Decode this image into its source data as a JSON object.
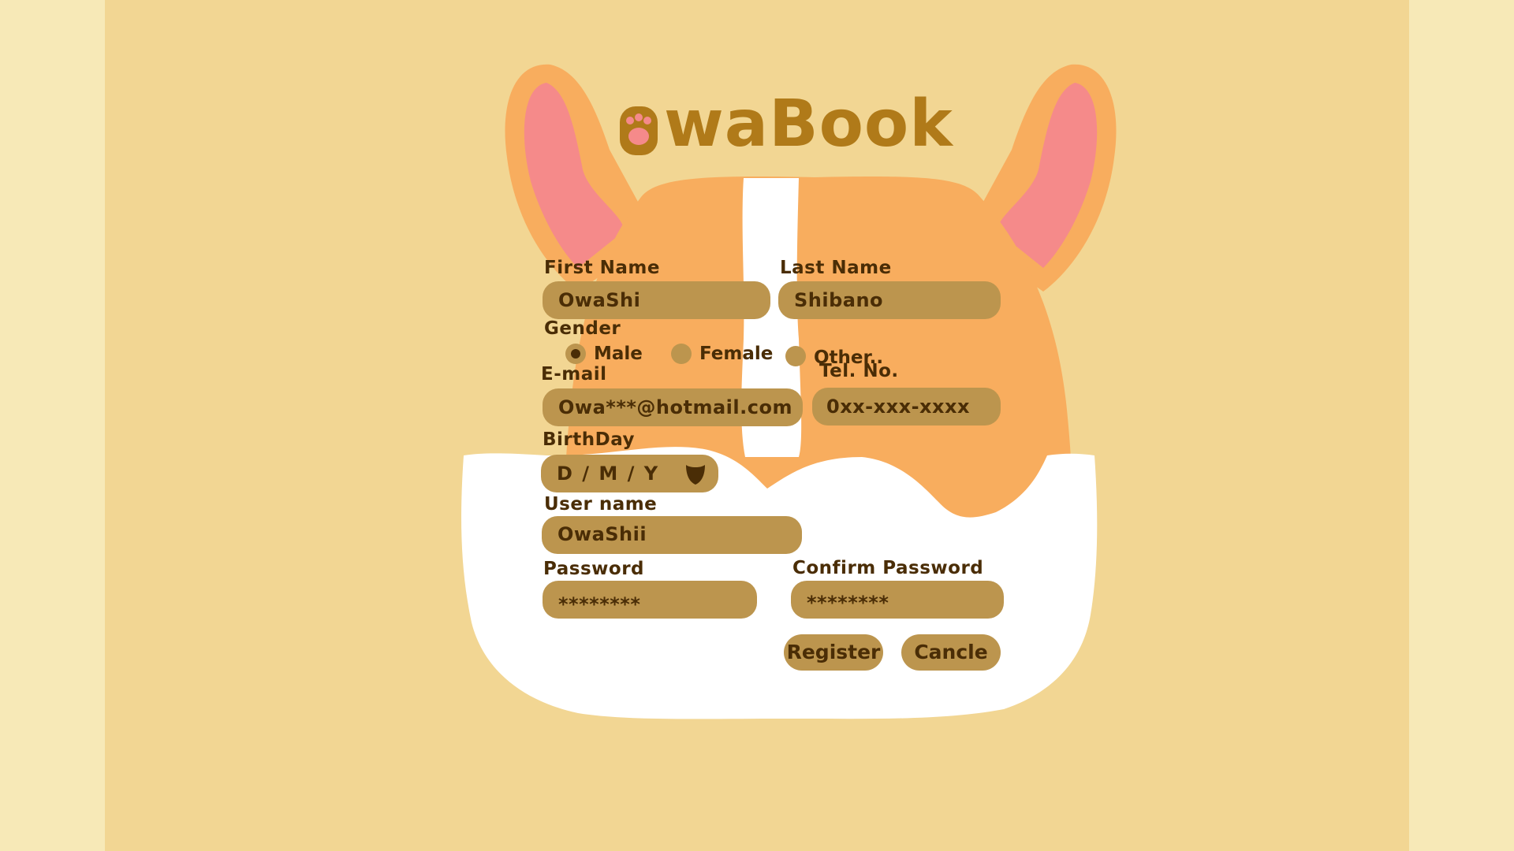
{
  "app": {
    "logo_text": "waBook"
  },
  "form": {
    "first_name": {
      "label": "First Name",
      "value": "OwaShi"
    },
    "last_name": {
      "label": "Last Name",
      "value": "Shibano"
    },
    "gender": {
      "label": "Gender",
      "options": [
        {
          "label": "Male",
          "selected": true
        },
        {
          "label": "Female",
          "selected": false
        },
        {
          "label": "Other..",
          "selected": false
        }
      ]
    },
    "email": {
      "label": "E-mail",
      "value": "Owa***@hotmail.com"
    },
    "tel": {
      "label": "Tel. No.",
      "value": "0xx-xxx-xxxx"
    },
    "birthday": {
      "label": "BirthDay",
      "placeholder": "D / M / Y"
    },
    "username": {
      "label": "User name",
      "value": "OwaShii"
    },
    "password": {
      "label": "Password",
      "value": "********"
    },
    "confirm_password": {
      "label": "Confirm Password",
      "value": "********"
    },
    "register_label": "Register",
    "cancel_label": "Cancle"
  },
  "colors": {
    "background": "#f2d693",
    "side_background": "#f7e9b7",
    "corgi_orange": "#f8ad5e",
    "ear_pink": "#f58a8a",
    "field_fill": "#bc954e",
    "text_dark": "#4a2d06",
    "logo_brown": "#b07a19"
  }
}
